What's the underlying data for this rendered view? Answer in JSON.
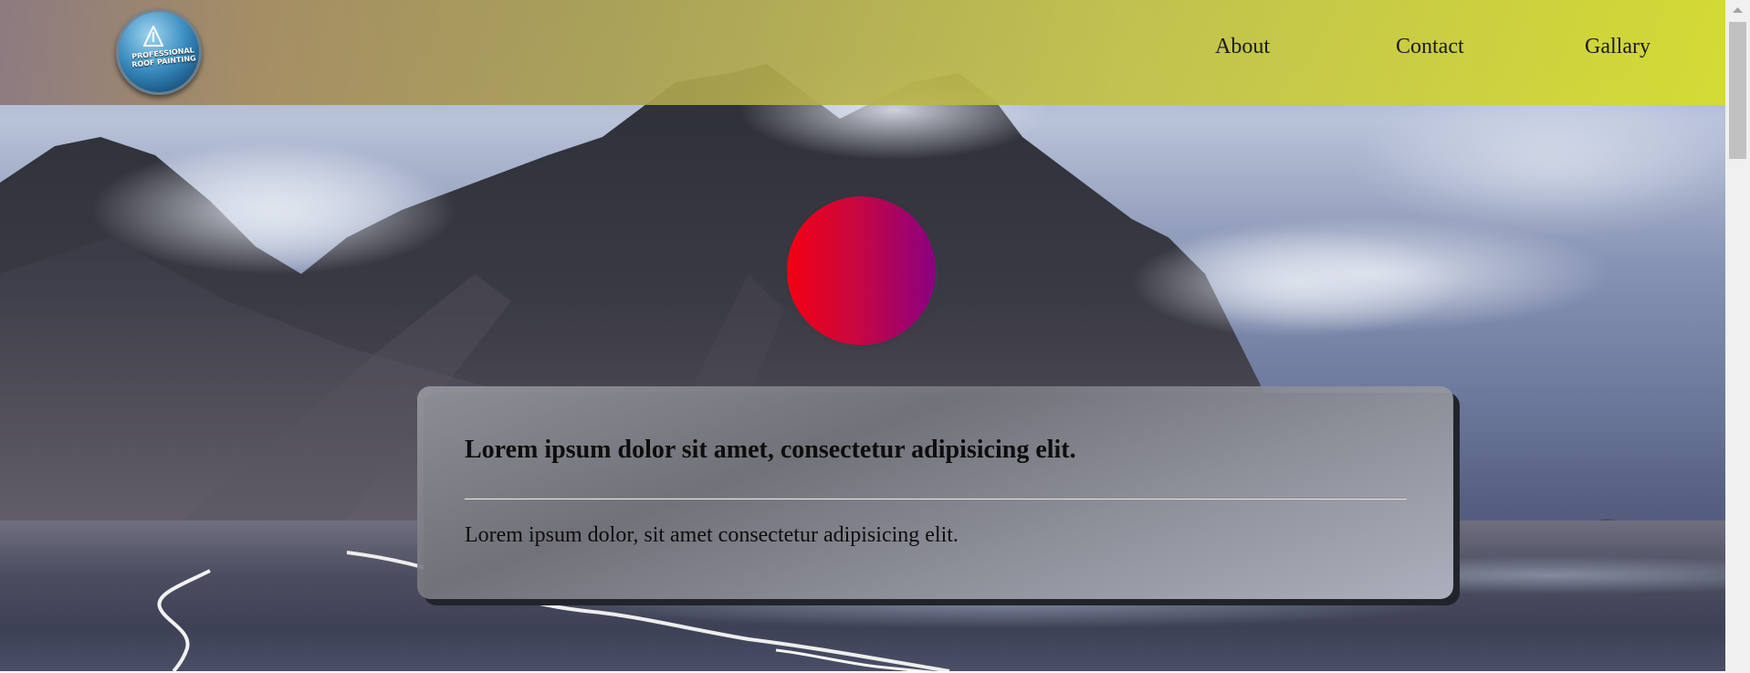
{
  "header": {
    "logo": {
      "icon": "roof-painting-logo-icon",
      "line1": "PROFESSIONAL",
      "line2": "ROOF PAINTING"
    },
    "nav": [
      {
        "label": "About"
      },
      {
        "label": "Contact"
      },
      {
        "label": "Gallary"
      }
    ],
    "gradient_colors": [
      "#8c787d",
      "#d6dc2d"
    ]
  },
  "hero": {
    "circle_gradient": [
      "#f40012",
      "#8a0082"
    ]
  },
  "card": {
    "title": "Lorem ipsum dolor sit amet, consectetur adipisicing elit.",
    "text": "Lorem ipsum dolor, sit amet consectetur adipisicing elit."
  },
  "scrollbar": {
    "up_icon": "scroll-up-arrow-icon"
  }
}
